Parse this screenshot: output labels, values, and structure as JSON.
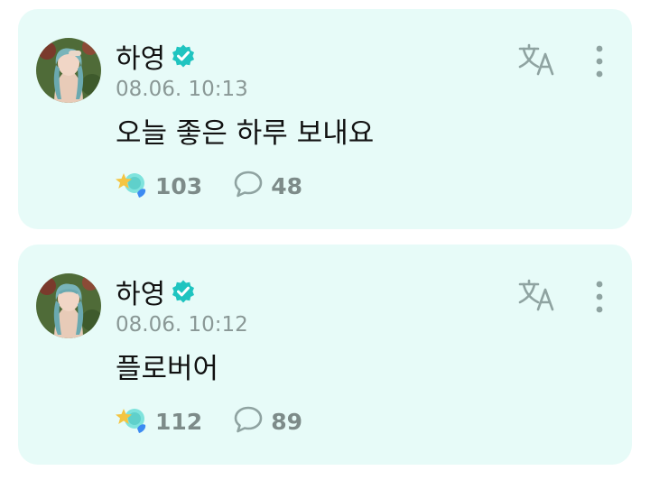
{
  "posts": [
    {
      "author": "하영",
      "verified_icon": "verified-check-icon",
      "timestamp": "08.06. 10:13",
      "text": "오늘 좋은 하루 보내요",
      "likes": "103",
      "comments": "48"
    },
    {
      "author": "하영",
      "verified_icon": "verified-check-icon",
      "timestamp": "08.06. 10:12",
      "text": "플로버어",
      "likes": "112",
      "comments": "89"
    }
  ],
  "colors": {
    "card_background": "#e7fbf8",
    "verified_badge": "#1fc4c0",
    "muted_text": "#8a9896",
    "icon_gray": "#8fa3a1"
  }
}
